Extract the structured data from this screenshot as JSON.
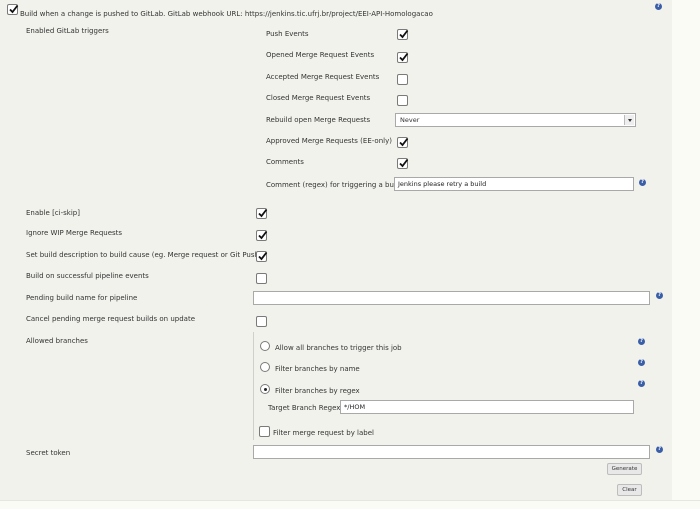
{
  "header": {
    "build_trigger_label": "Build when a change is pushed to GitLab. GitLab webhook URL: https://jenkins.tic.ufrj.br/project/EEI-API-Homologacao",
    "build_trigger_checked": true
  },
  "enabled_triggers": {
    "label": "Enabled GitLab triggers",
    "push_events": "Push Events",
    "opened_mr": "Opened Merge Request Events",
    "accepted_mr": "Accepted Merge Request Events",
    "closed_mr": "Closed Merge Request Events",
    "rebuild_open_mr": "Rebuild open Merge Requests",
    "rebuild_value": "Never",
    "approved_mr": "Approved Merge Requests (EE-only)",
    "comments": "Comments",
    "comment_regex_label": "Comment (regex) for triggering a build",
    "comment_regex_value": "Jenkins please retry a build"
  },
  "options": {
    "ci_skip": "Enable [ci-skip]",
    "ignore_wip": "Ignore WIP Merge Requests",
    "set_build_description": "Set build description to build cause (eg. Merge request or Git Push )",
    "build_on_pipeline": "Build on successful pipeline events",
    "pending_build_name": "Pending build name for pipeline",
    "pending_build_value": "",
    "cancel_pending": "Cancel pending merge request builds on update"
  },
  "branches": {
    "label": "Allowed branches",
    "allow_all": "Allow all branches to trigger this job",
    "by_name": "Filter branches by name",
    "by_regex": "Filter branches by regex",
    "target_regex_label": "Target Branch Regex",
    "target_regex_value": "*/HOM",
    "by_label": "Filter merge request by label"
  },
  "secret": {
    "label": "Secret token",
    "value": "",
    "generate_label": "Generate",
    "clear_label": "Clear"
  },
  "icons": {
    "help": "?"
  }
}
